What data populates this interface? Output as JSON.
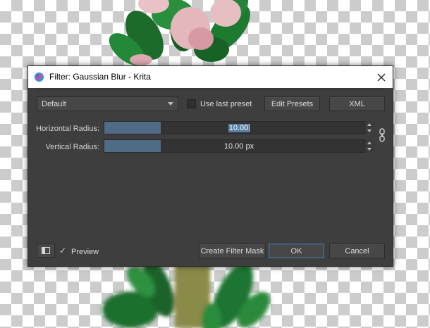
{
  "window": {
    "title": "Filter: Gaussian Blur - Krita",
    "close_glyph": "✕"
  },
  "presets": {
    "selected": "Default",
    "use_last_preset_label": "Use last preset",
    "use_last_preset_checked": false,
    "edit_presets_label": "Edit Presets",
    "xml_label": "XML"
  },
  "params": {
    "horizontal": {
      "label": "Horizontal Radius:",
      "value_text": "10.00",
      "value": 10.0,
      "fill_fraction": 0.21,
      "editing": true
    },
    "vertical": {
      "label": "Vertical Radius:",
      "value_text": "10.00 px",
      "value": 10.0,
      "fill_fraction": 0.21
    },
    "aspect_lock_icon": "chain-link-icon"
  },
  "footer": {
    "panel_toggle_icon": "panel-toggle-icon",
    "preview_checked": true,
    "preview_check_glyph": "✓",
    "preview_label": "Preview",
    "create_mask_label": "Create Filter Mask",
    "ok_label": "OK",
    "cancel_label": "Cancel"
  },
  "colors": {
    "dialog_bg": "#3e3e3e",
    "slider_fill": "#4f6b86",
    "default_button_border": "#4d6b8c"
  }
}
